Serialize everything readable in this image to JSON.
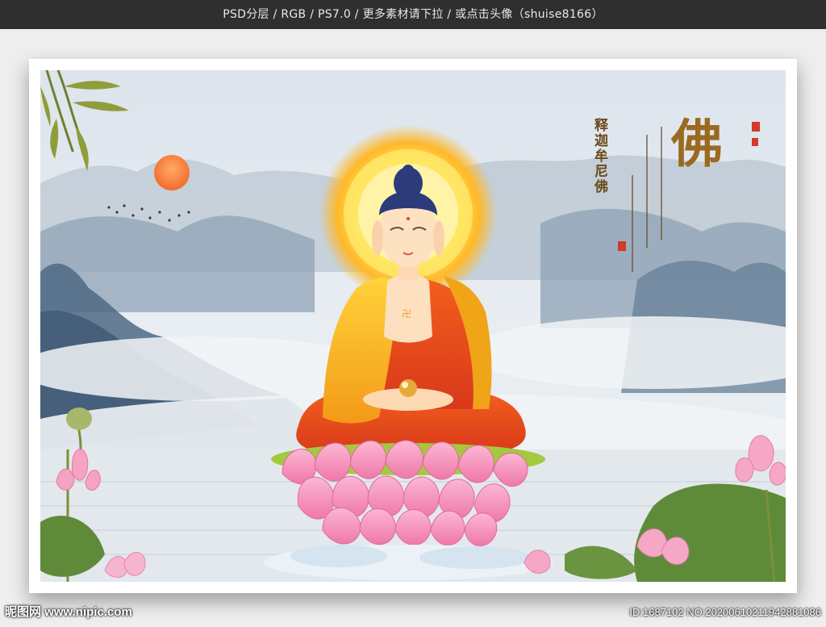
{
  "top_banner": "PSD分层 / RGB / PS7.0 / 更多素材请下拉 / 或点击头像（shuise8166）",
  "calligraphy": {
    "main_char": "佛",
    "name_vertical": "释迦牟尼佛"
  },
  "watermark": {
    "logo": "昵图网 www.nipic.com",
    "image_id": "ID:1687102 NO:20200610211942881086"
  },
  "colors": {
    "halo": "#ffd21f",
    "robe_outer": "#f0a21a",
    "robe_inner": "#e2461a",
    "lotus": "#f48ab8",
    "sky": "#dfe6ee"
  }
}
